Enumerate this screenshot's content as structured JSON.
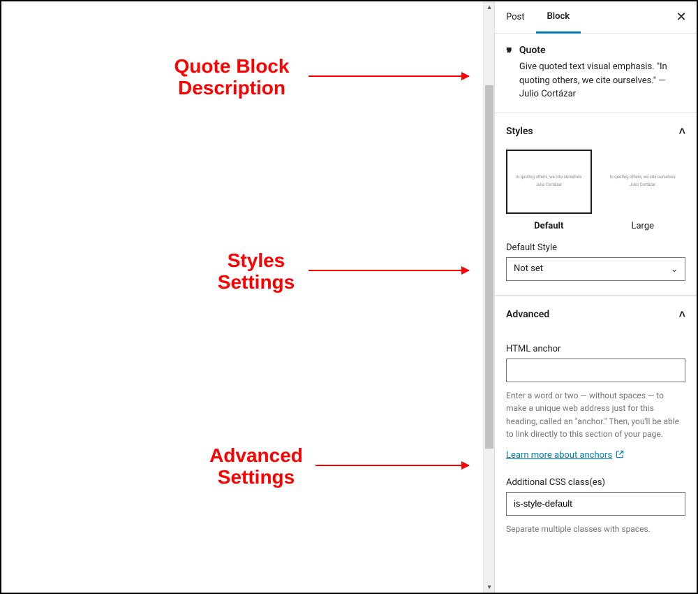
{
  "tabs": {
    "post": "Post",
    "block": "Block"
  },
  "block": {
    "name": "Quote",
    "description": "Give quoted text visual emphasis. \"In quoting others, we cite ourselves.\" — Julio Cortázar"
  },
  "styles": {
    "heading": "Styles",
    "sample_quote": "In quoting others, we cite ourselves",
    "sample_cite": "Julio Cortázar",
    "options": [
      {
        "label": "Default"
      },
      {
        "label": "Large"
      }
    ],
    "default_style_label": "Default Style",
    "default_style_value": "Not set"
  },
  "advanced": {
    "heading": "Advanced",
    "anchor_label": "HTML anchor",
    "anchor_value": "",
    "anchor_help": "Enter a word or two — without spaces — to make a unique web address just for this heading, called an \"anchor.\" Then, you'll be able to link directly to this section of your page.",
    "anchor_link_text": "Learn more about anchors",
    "css_label": "Additional CSS class(es)",
    "css_value": "is-style-default",
    "css_help": "Separate multiple classes with spaces."
  },
  "annotations": {
    "desc": "Quote Block\nDescription",
    "styles": "Styles\nSettings",
    "advanced": "Advanced\nSettings"
  }
}
